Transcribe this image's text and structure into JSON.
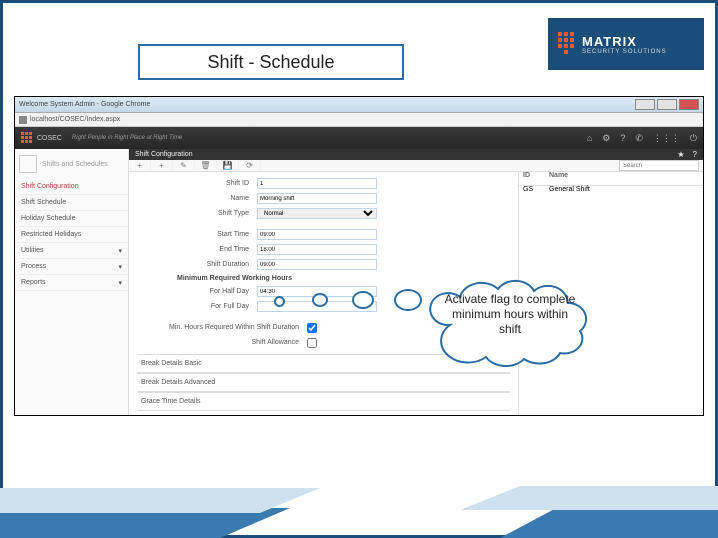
{
  "slide": {
    "title": "Shift - Schedule",
    "callout": "Activate flag to complete minimum hours within shift",
    "logo_main": "MATRIX",
    "logo_sub": "SECURITY SOLUTIONS"
  },
  "window": {
    "title": "Welcome System Admin - Google Chrome",
    "url": "localhost/COSEC/Index.aspx"
  },
  "app": {
    "brand": "COSEC",
    "tagline": "Right People in Right Place at Right Time",
    "header_icons": {
      "home": "⌂",
      "gear": "⚙",
      "help": "?",
      "phone": "✆",
      "grid": "⋮⋮⋮",
      "power": "⏻"
    }
  },
  "nav": {
    "header": "Shifts and Schedules",
    "items": [
      {
        "label": "Shift Configuration"
      },
      {
        "label": "Shift Schedule"
      },
      {
        "label": "Holiday Schedule"
      },
      {
        "label": "Restricted Holidays"
      },
      {
        "label": "Utilities"
      },
      {
        "label": "Process"
      },
      {
        "label": "Reports"
      }
    ]
  },
  "panel": {
    "title": "Shift Configuration",
    "toolbar": {
      "add": "+",
      "add2": "+",
      "edit": "✎",
      "delete": "🗑",
      "save": "💾",
      "refresh": "⟳",
      "star_icon": "★",
      "help_icon": "?"
    },
    "search_placeholder": "Search",
    "fields": {
      "shift_id_label": "Shift ID",
      "shift_id": "1",
      "name_label": "Name",
      "name": "Morning shift",
      "shift_type_label": "Shift Type",
      "shift_type": "Normal",
      "start_label": "Start Time",
      "start": "09:00",
      "end_label": "End Time",
      "end": "18:00",
      "duration_label": "Shift Duration",
      "duration": "09:00",
      "min_section": "Minimum Required Working Hours",
      "half_label": "For Half Day",
      "half": "04:30",
      "full_label": "For Full Day",
      "flag_label": "Min. Hours Required Within Shift Duration",
      "allowance_label": "Shift Allowance"
    },
    "sections": [
      {
        "label": "Break Details Basic"
      },
      {
        "label": "Break Details Advanced"
      },
      {
        "label": "Grace Time Details"
      }
    ]
  },
  "list": {
    "col_id": "ID",
    "col_name": "Name",
    "rows": [
      {
        "id": "GS",
        "name": "General Shift"
      }
    ]
  }
}
